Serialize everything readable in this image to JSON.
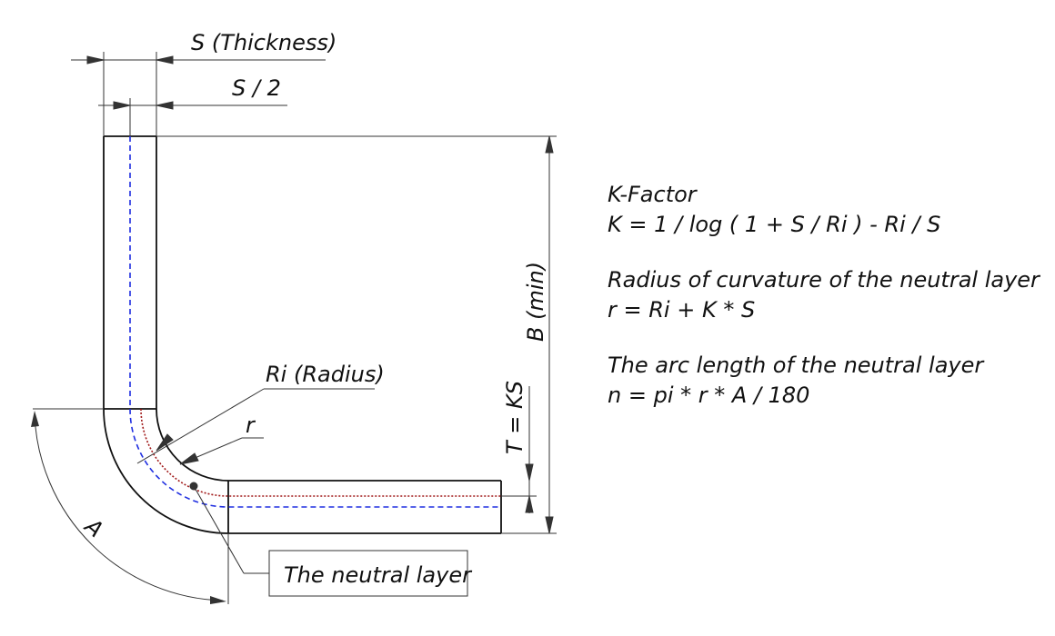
{
  "labels": {
    "thickness": "S (Thickness)",
    "half_thickness": "S / 2",
    "b_min": "B (min)",
    "radius": "Ri (Radius)",
    "r": "r",
    "t_ks": "T = KS",
    "angle": "A",
    "neutral_layer": "The neutral layer"
  },
  "formulas": {
    "k_factor_title": "K-Factor",
    "k_factor_expr": "K = 1 / log ( 1 + S / Ri ) - Ri / S",
    "radius_title": "Radius of curvature of the neutral layer",
    "radius_expr": "r = Ri + K * S",
    "arc_title": "The arc length of the neutral layer",
    "arc_expr": "n = pi * r * A / 180"
  },
  "colors": {
    "outline": "#111111",
    "dimension": "#333333",
    "half_thickness_line": "#1f2ee0",
    "neutral_line": "#a01818"
  }
}
